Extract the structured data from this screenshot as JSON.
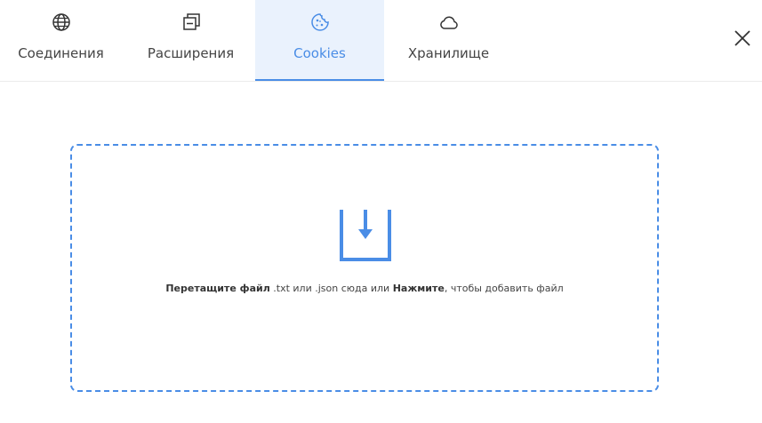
{
  "tabs": [
    {
      "label": "Соединения",
      "icon": "globe-icon",
      "active": false
    },
    {
      "label": "Расширения",
      "icon": "extensions-icon",
      "active": false
    },
    {
      "label": "Cookies",
      "icon": "cookie-icon",
      "active": true
    },
    {
      "label": "Хранилище",
      "icon": "cloud-icon",
      "active": false
    }
  ],
  "close": {
    "icon": "close-icon"
  },
  "dropzone": {
    "icon": "download-tray-icon",
    "strong_1": "Перетащите файл",
    "text_1": " .txt или .json сюда или ",
    "strong_2": "Нажмите",
    "text_2": ", чтобы добавить файл"
  },
  "colors": {
    "accent": "#4a8de6",
    "active_tab_bg": "#eaf2fd"
  }
}
